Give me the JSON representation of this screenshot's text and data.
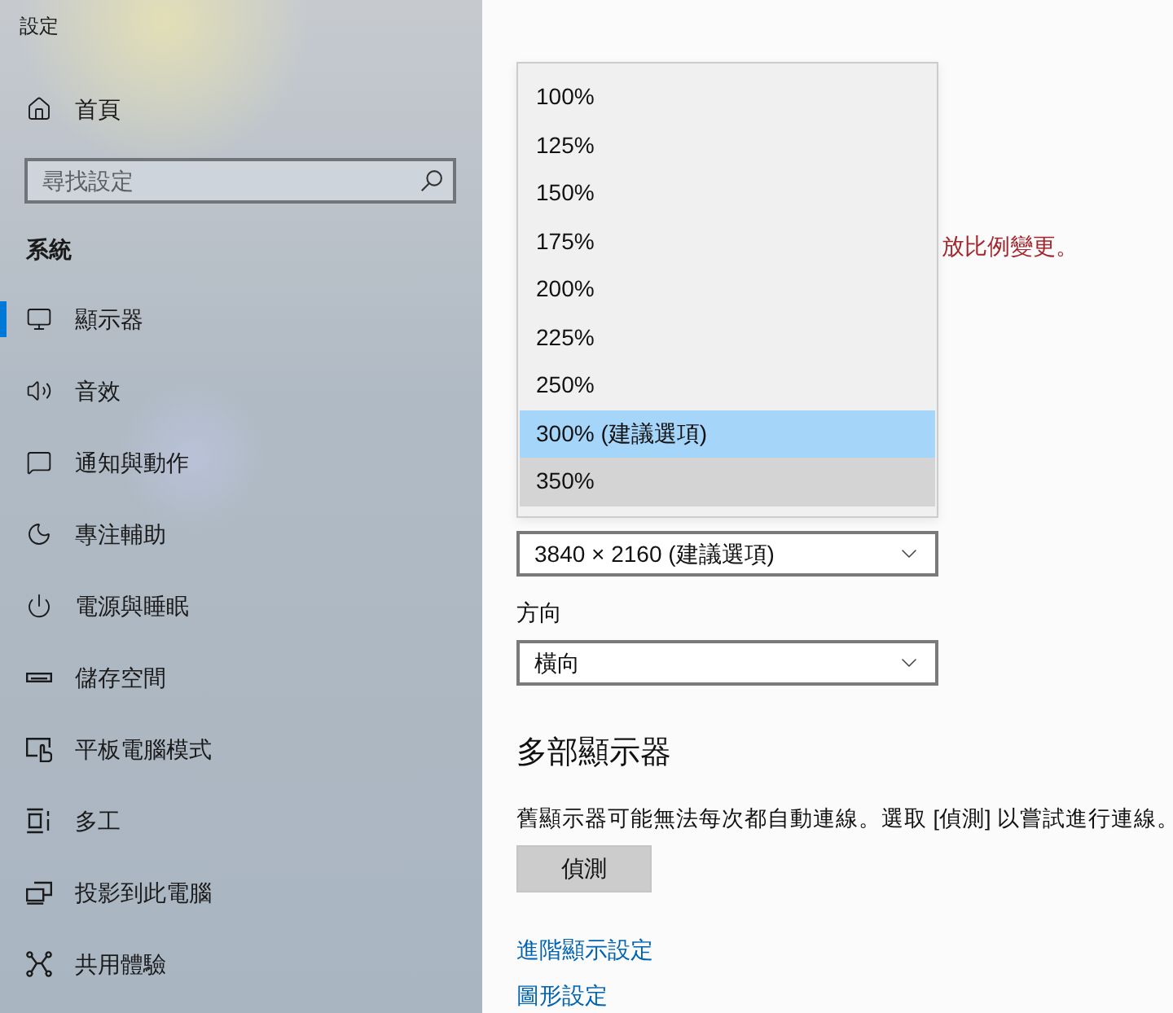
{
  "window": {
    "title": "設定"
  },
  "sidebar": {
    "home": {
      "label": "首頁"
    },
    "search": {
      "placeholder": "尋找設定"
    },
    "section": "系統",
    "items": [
      {
        "label": "顯示器",
        "selected": true
      },
      {
        "label": "音效",
        "selected": false
      },
      {
        "label": "通知與動作",
        "selected": false
      },
      {
        "label": "專注輔助",
        "selected": false
      },
      {
        "label": "電源與睡眠",
        "selected": false
      },
      {
        "label": "儲存空間",
        "selected": false
      },
      {
        "label": "平板電腦模式",
        "selected": false
      },
      {
        "label": "多工",
        "selected": false
      },
      {
        "label": "投影到此電腦",
        "selected": false
      },
      {
        "label": "共用體驗",
        "selected": false
      }
    ]
  },
  "main": {
    "scale_dropdown": {
      "options": [
        {
          "label": "100%",
          "selected": false,
          "hovered": false
        },
        {
          "label": "125%",
          "selected": false,
          "hovered": false
        },
        {
          "label": "150%",
          "selected": false,
          "hovered": false
        },
        {
          "label": "175%",
          "selected": false,
          "hovered": false
        },
        {
          "label": "200%",
          "selected": false,
          "hovered": false
        },
        {
          "label": "225%",
          "selected": false,
          "hovered": false
        },
        {
          "label": "250%",
          "selected": false,
          "hovered": false
        },
        {
          "label": "300% (建議選項)",
          "selected": true,
          "hovered": false
        },
        {
          "label": "350%",
          "selected": false,
          "hovered": true
        }
      ]
    },
    "notice": "放比例變更。",
    "resolution": {
      "value": "3840 × 2160 (建議選項)"
    },
    "orientation": {
      "label": "方向",
      "value": "橫向"
    },
    "multiple_displays": {
      "heading": "多部顯示器",
      "description": "舊顯示器可能無法每次都自動連線。選取 [偵測] 以嘗試進行連線。",
      "button": "偵測"
    },
    "links": [
      "進階顯示設定",
      "圖形設定"
    ]
  }
}
